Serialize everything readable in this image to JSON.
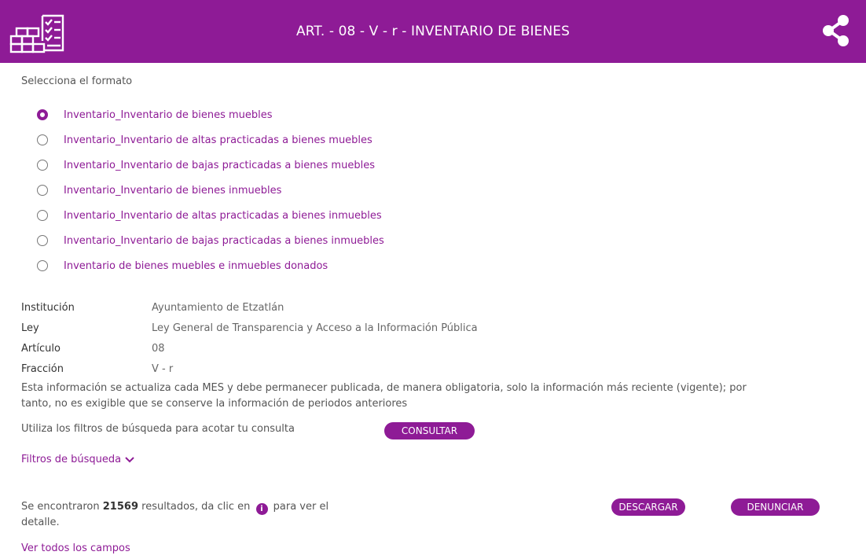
{
  "header": {
    "title": "ART. - 08 - V - r - INVENTARIO DE BIENES",
    "logo_icon": "inventory-checklist-icon",
    "share_icon": "share-icon",
    "background": "#8e1b96"
  },
  "format_label": "Selecciona el formato",
  "formats": [
    {
      "label": "Inventario_Inventario de bienes muebles",
      "checked": true
    },
    {
      "label": "Inventario_Inventario de altas practicadas a bienes muebles",
      "checked": false
    },
    {
      "label": "Inventario_Inventario de bajas practicadas a bienes muebles",
      "checked": false
    },
    {
      "label": "Inventario_Inventario de bienes inmuebles",
      "checked": false
    },
    {
      "label": "Inventario_Inventario de altas practicadas a bienes inmuebles",
      "checked": false
    },
    {
      "label": "Inventario_Inventario de bajas practicadas a bienes inmuebles",
      "checked": false
    },
    {
      "label": "Inventario de bienes muebles e inmuebles donados",
      "checked": false
    }
  ],
  "info": {
    "institucion": {
      "key": "Institución",
      "value": "Ayuntamiento de Etzatlán"
    },
    "ley": {
      "key": "Ley",
      "value": "Ley General de Transparencia y Acceso a la Información Pública"
    },
    "articulo": {
      "key": "Artículo",
      "value": "08"
    },
    "fraccion": {
      "key": "Fracción",
      "value": "V - r"
    }
  },
  "note": "Esta información se actualiza cada MES y debe permanecer publicada, de manera obligatoria, solo la información más reciente (vigente); por tanto, no es exigible que se conserve la información de periodos anteriores",
  "filters": {
    "text": "Utiliza los filtros de búsqueda para acotar tu consulta",
    "consultar": "CONSULTAR",
    "toggle": "Filtros de búsqueda"
  },
  "results": {
    "prefix": "Se encontraron ",
    "count": "21569",
    "middle": " resultados, da clic en ",
    "info_glyph": "i",
    "suffix": " para ver el detalle."
  },
  "buttons": {
    "descargar": "DESCARGAR",
    "denunciar": "DENUNCIAR"
  },
  "ver_todos": "Ver todos los campos",
  "colors": {
    "accent": "#8e1b96"
  }
}
